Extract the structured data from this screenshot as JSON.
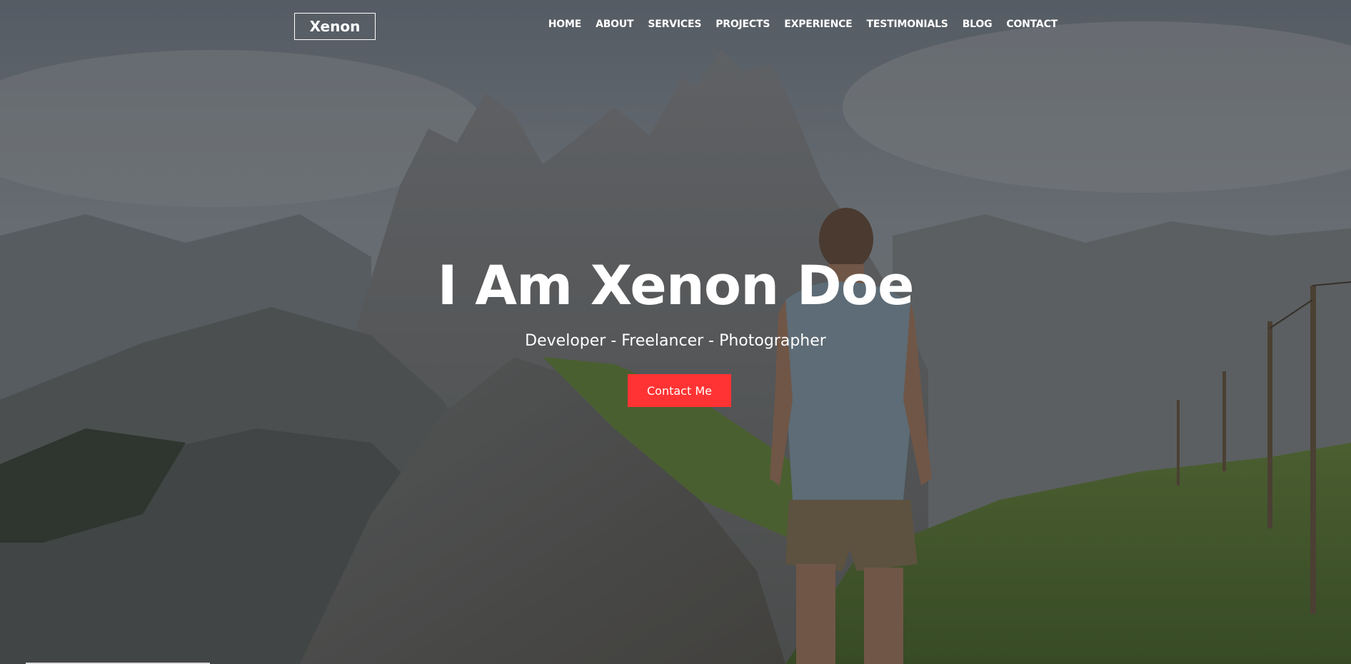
{
  "brand": {
    "logo_text": "Xenon"
  },
  "nav": {
    "items": [
      {
        "label": "HOME"
      },
      {
        "label": "ABOUT"
      },
      {
        "label": "SERVICES"
      },
      {
        "label": "PROJECTS"
      },
      {
        "label": "EXPERIENCE"
      },
      {
        "label": "TESTIMONIALS"
      },
      {
        "label": "BLOG"
      },
      {
        "label": "CONTACT"
      }
    ]
  },
  "hero": {
    "headline": "I Am Xenon Doe",
    "subtitle": "Developer - Freelancer - Photographer",
    "cta_label": "Contact Me",
    "background_image": "mountain-landscape-photo"
  },
  "colors": {
    "accent": "#ff3333",
    "text": "#ffffff",
    "overlay": "#14181e"
  }
}
